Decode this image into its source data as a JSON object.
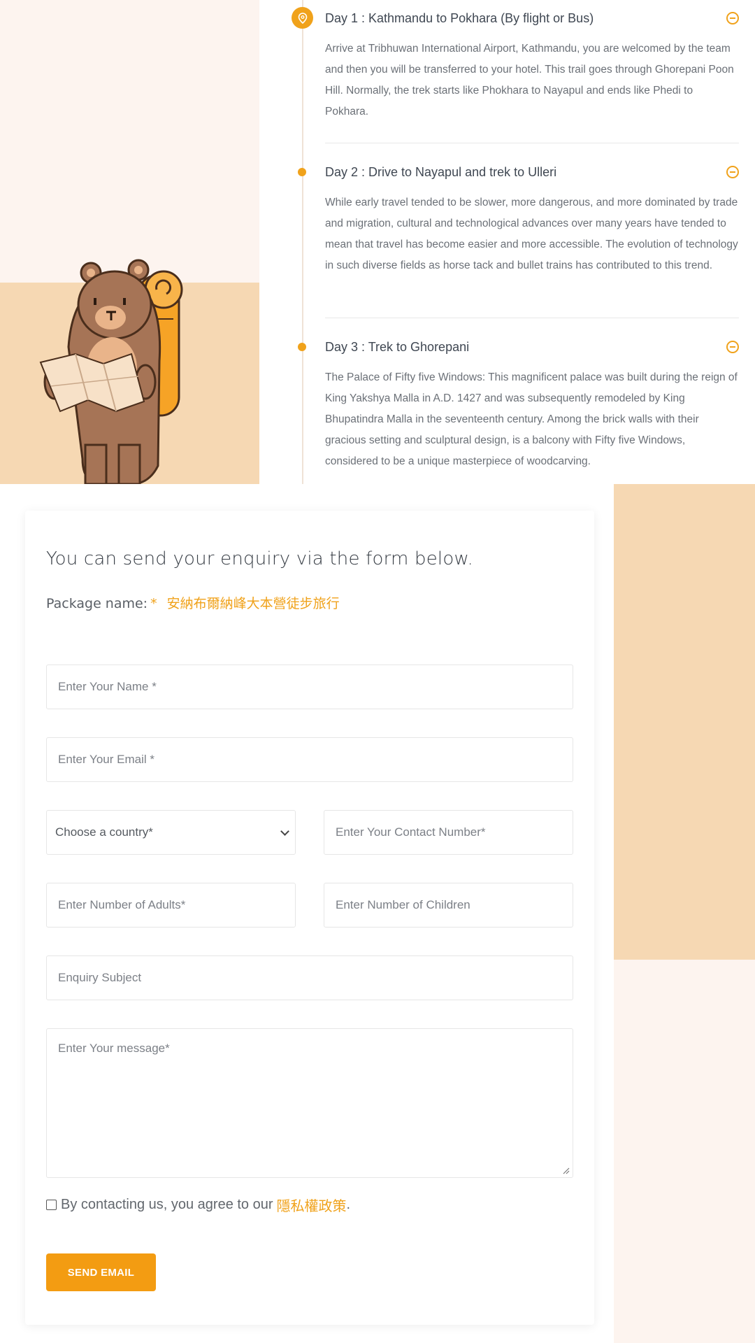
{
  "itinerary": {
    "days": [
      {
        "title": "Day 1 : Kathmandu to Pokhara (By flight or Bus)",
        "body": "Arrive at Tribhuwan International Airport, Kathmandu, you are welcomed by the team and then you will be transferred to your hotel. This trail goes through Ghorepani Poon Hill. Normally, the trek starts like Phokhara to Nayapul and ends like Phedi to Pokhara."
      },
      {
        "title": "Day 2 : Drive to Nayapul and trek to Ulleri",
        "body": "While early travel tended to be slower, more dangerous, and more dominated by trade and migration, cultural and technological advances over many years have tended to mean that travel has become easier and more accessible. The evolution of technology in such diverse fields as horse tack and bullet trains has contributed to this trend."
      },
      {
        "title": "Day 3 : Trek to Ghorepani",
        "body": "The Palace of Fifty five Windows: This magnificent palace was built during the reign of King Yakshya Malla in A.D. 1427 and was subsequently remodeled by King Bhupatindra Malla in the seventeenth century. Among the brick walls with their gracious setting and sculptural design, is a balcony with Fifty five Windows, considered to be a unique masterpiece of woodcarving."
      }
    ]
  },
  "form": {
    "heading": "You can send your enquiry via the form below.",
    "package_label": "Package name:",
    "required_mark": "*",
    "package_name": "安納布爾納峰大本營徒步旅行",
    "name_placeholder": "Enter Your Name *",
    "email_placeholder": "Enter Your Email *",
    "country_selected": "Choose a country*",
    "contact_placeholder": "Enter Your Contact Number*",
    "adults_placeholder": "Enter Number of Adults*",
    "children_placeholder": "Enter Number of Children",
    "subject_placeholder": "Enquiry Subject",
    "message_placeholder": "Enter Your message*",
    "agree_text": "By contacting us, you agree to our",
    "privacy_link": "隱私權政策",
    "agree_period": ".",
    "submit_label": "SEND EMAIL"
  },
  "colors": {
    "accent": "#f0a21b",
    "peach": "#f6d8b3",
    "cream": "#fdf4ef"
  }
}
